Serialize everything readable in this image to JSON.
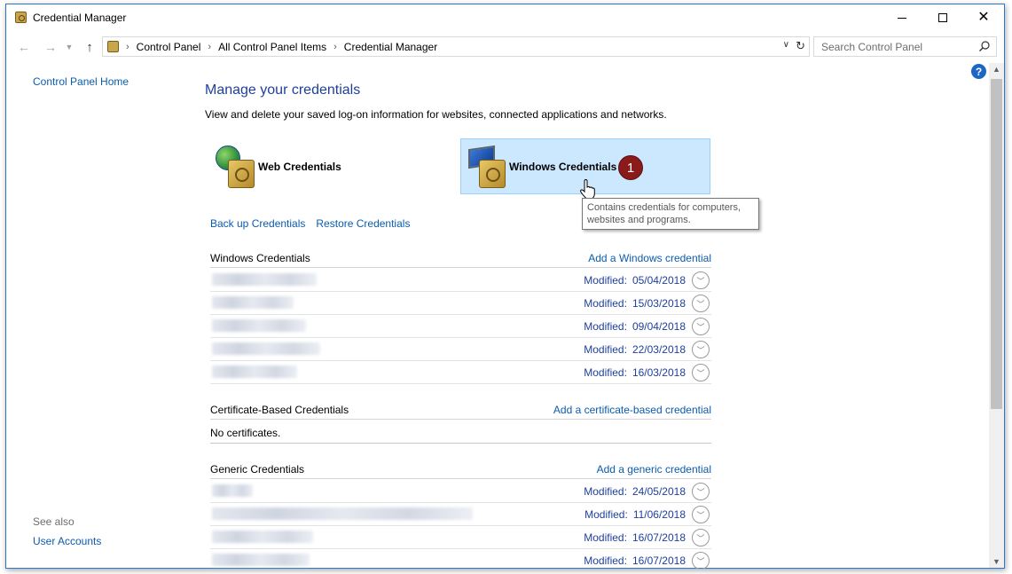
{
  "window": {
    "title": "Credential Manager"
  },
  "address": {
    "crumbs": [
      "Control Panel",
      "All Control Panel Items",
      "Credential Manager"
    ]
  },
  "search": {
    "placeholder": "Search Control Panel"
  },
  "left": {
    "home": "Control Panel Home",
    "see_also": "See also",
    "user_accounts": "User Accounts"
  },
  "main": {
    "title": "Manage your credentials",
    "description": "View and delete your saved log-on information for websites, connected applications and networks.",
    "web_tile": "Web Credentials",
    "windows_tile": "Windows Credentials",
    "badge": "1",
    "tooltip": "Contains credentials for computers, websites and programs.",
    "backup": "Back up Credentials",
    "restore": "Restore Credentials"
  },
  "sections": {
    "windows": {
      "name": "Windows Credentials",
      "add": "Add a Windows credential",
      "rows": [
        {
          "label": "Modified:",
          "date": "05/04/2018"
        },
        {
          "label": "Modified:",
          "date": "15/03/2018"
        },
        {
          "label": "Modified:",
          "date": "09/04/2018"
        },
        {
          "label": "Modified:",
          "date": "22/03/2018"
        },
        {
          "label": "Modified:",
          "date": "16/03/2018"
        }
      ]
    },
    "certificate": {
      "name": "Certificate-Based Credentials",
      "add": "Add a certificate-based credential",
      "empty": "No certificates."
    },
    "generic": {
      "name": "Generic Credentials",
      "add": "Add a generic credential",
      "rows": [
        {
          "label": "Modified:",
          "date": "24/05/2018"
        },
        {
          "label": "Modified:",
          "date": "11/06/2018"
        },
        {
          "label": "Modified:",
          "date": "16/07/2018"
        },
        {
          "label": "Modified:",
          "date": "16/07/2018"
        }
      ]
    }
  },
  "colors": {
    "link": "#0b5cad",
    "title_blue": "#1e3f9c",
    "selection": "#cce8ff",
    "badge": "#8b1a1a"
  }
}
